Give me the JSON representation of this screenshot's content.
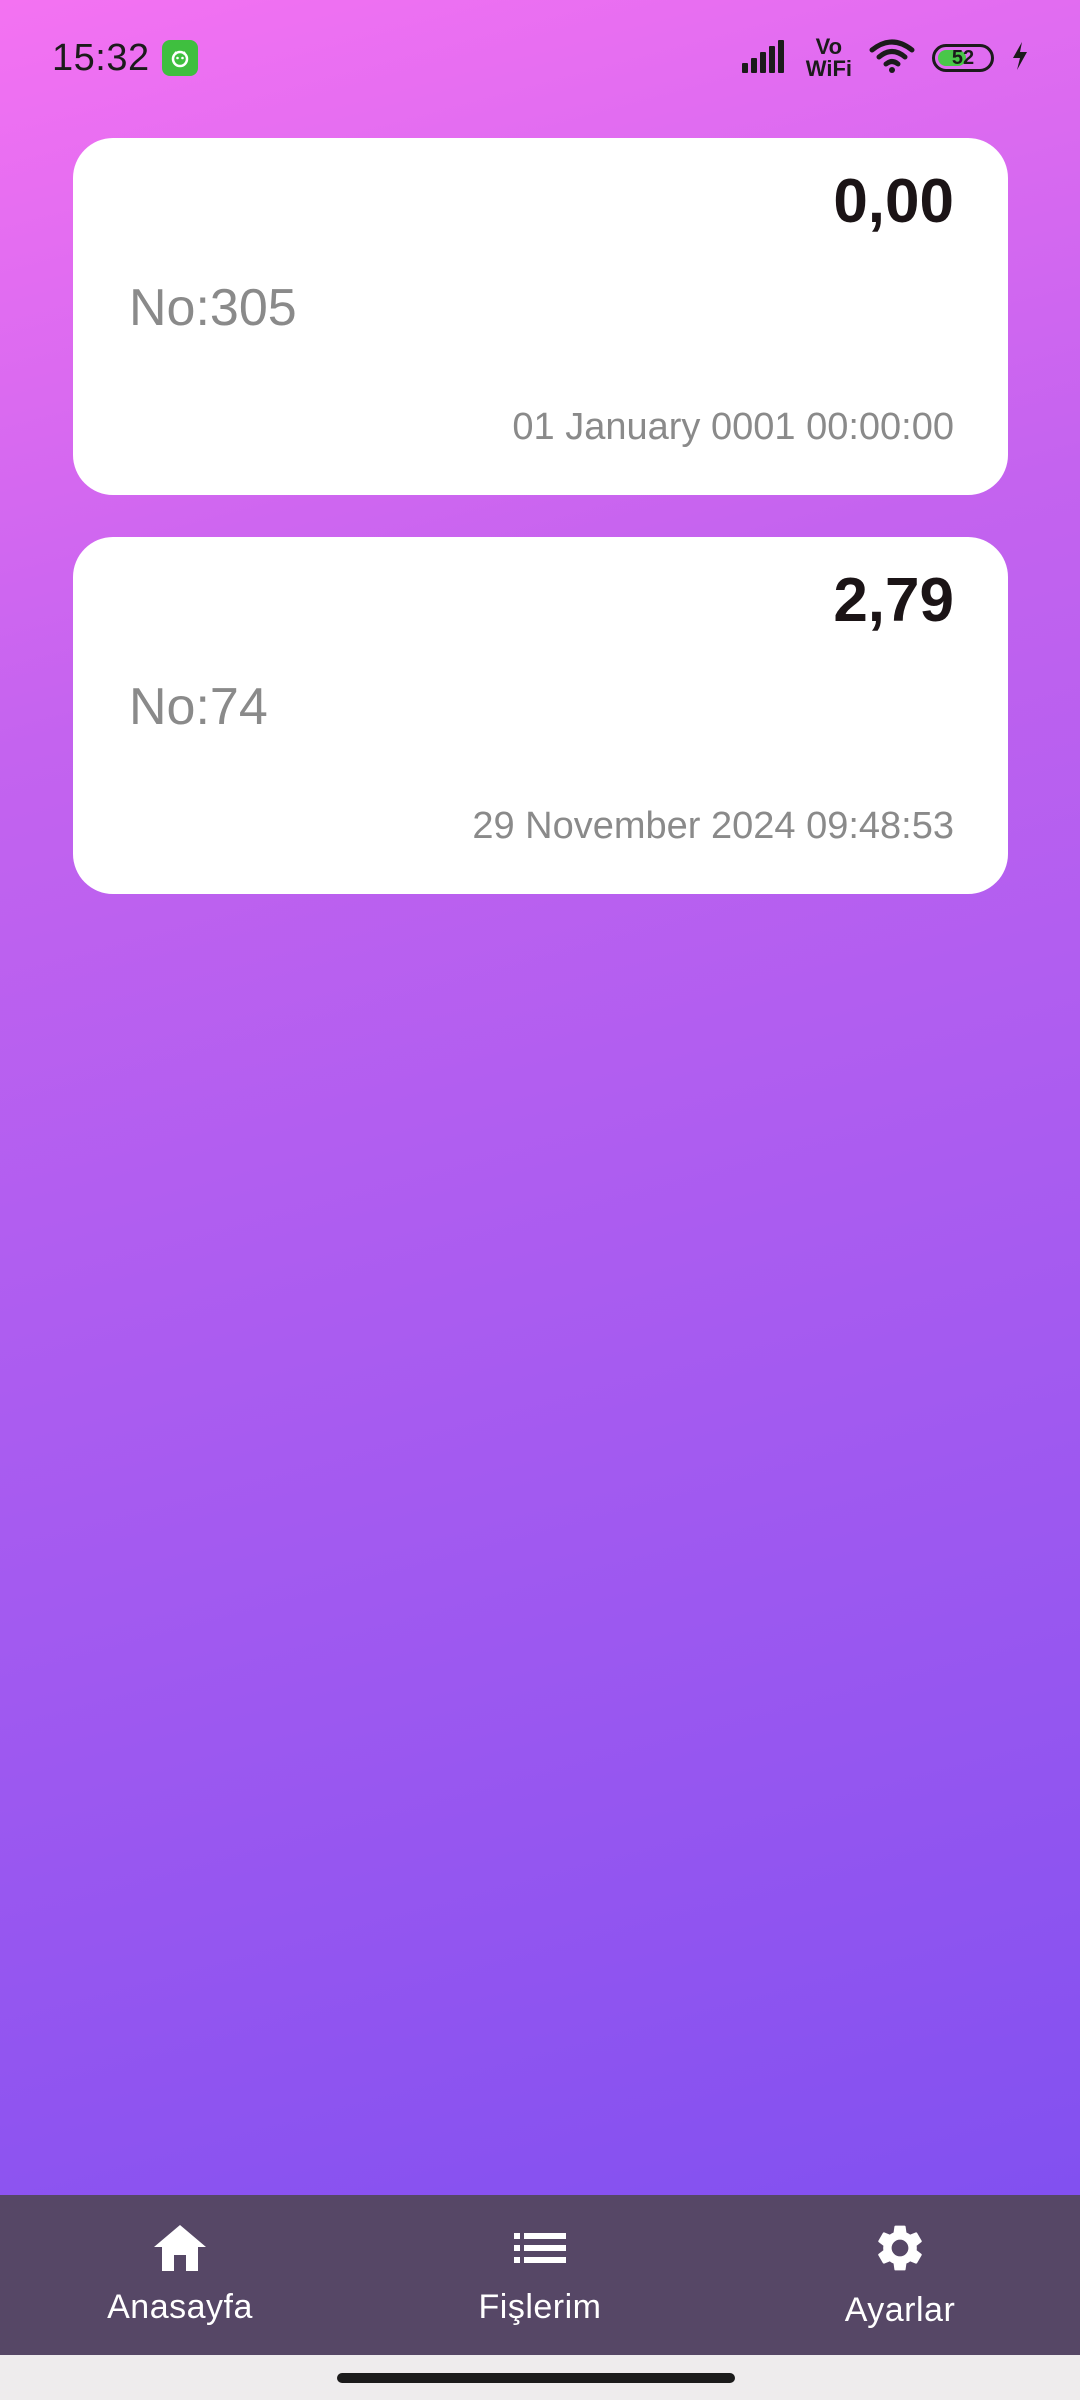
{
  "status_bar": {
    "time": "15:32",
    "network_label_top": "Vo",
    "network_label_bottom": "WiFi",
    "battery_level": "52"
  },
  "receipts": [
    {
      "amount": "0,00",
      "number": "No:305",
      "date": "01 January 0001 00:00:00"
    },
    {
      "amount": "2,79",
      "number": "No:74",
      "date": "29 November 2024 09:48:53"
    }
  ],
  "bottom_nav": {
    "items": [
      {
        "label": "Anasayfa",
        "icon": "home-icon"
      },
      {
        "label": "Fişlerim",
        "icon": "list-icon"
      },
      {
        "label": "Ayarlar",
        "icon": "gear-icon"
      }
    ]
  },
  "colors": {
    "gradient_top": "#f472f2",
    "gradient_bottom": "#7a4ef0",
    "nav_background": "#564766"
  }
}
